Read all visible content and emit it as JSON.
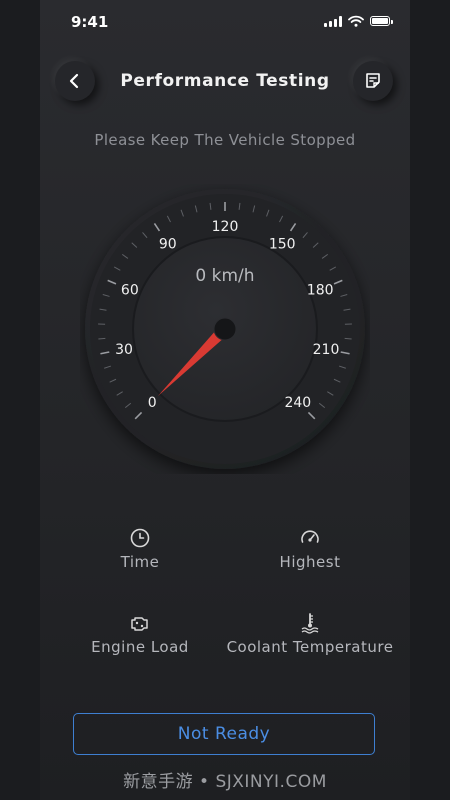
{
  "status_bar": {
    "time": "9:41"
  },
  "header": {
    "title": "Performance Testing"
  },
  "subtitle": "Please Keep The Vehicle Stopped",
  "gauge": {
    "speed_readout": "0 km/h",
    "tick_labels": [
      "0",
      "30",
      "60",
      "90",
      "120",
      "150",
      "180",
      "210",
      "240"
    ],
    "min": 0,
    "max": 240,
    "current_value": 0,
    "needle_color": "#d93a33"
  },
  "metrics": {
    "time": {
      "label": "Time",
      "icon": "clock-icon"
    },
    "highest": {
      "label": "Highest",
      "icon": "speedometer-icon"
    },
    "engine_load": {
      "label": "Engine Load",
      "icon": "engine-icon"
    },
    "coolant": {
      "label": "Coolant Temperature",
      "icon": "coolant-thermometer-icon"
    }
  },
  "action": {
    "label": "Not Ready",
    "color": "#3e7fd1"
  },
  "watermark": "新意手游 • SJXINYI.COM"
}
